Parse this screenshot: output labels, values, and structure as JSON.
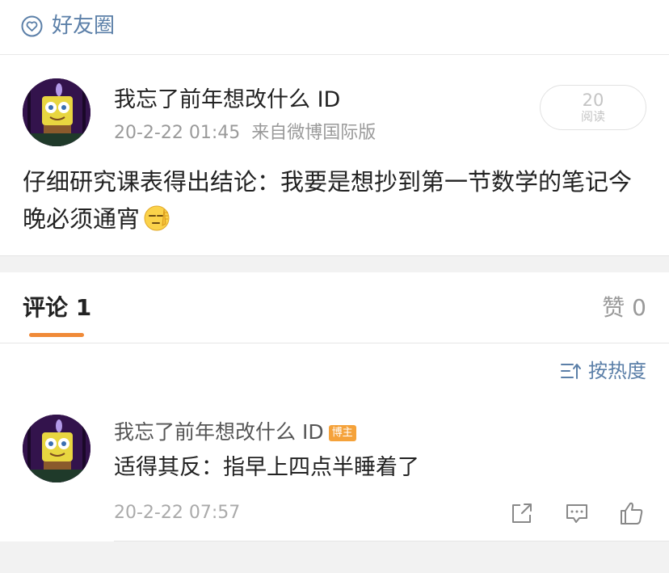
{
  "header": {
    "title": "好友圈",
    "icon": "heart-circle-icon",
    "accent": "#5b7fa8"
  },
  "post": {
    "author": "我忘了前年想改什么 ID",
    "time": "20-2-22 01:45",
    "source": "来自微博国际版",
    "reads": {
      "count": "20",
      "label": "阅读"
    },
    "text": "仔细研究课表得出结论：我要是想抄到第一节数学的笔记今晚必须通宵",
    "emoji": "awkward-salute-emoji"
  },
  "comments_section": {
    "tab_comments": "评论 1",
    "tab_likes": "赞 0",
    "sort_label": "按热度",
    "accent": "#f08a38",
    "items": [
      {
        "author": "我忘了前年想改什么 ID",
        "badge": "博主",
        "text": "适得其反：指早上四点半睡着了",
        "time": "20-2-22 07:57"
      }
    ]
  }
}
